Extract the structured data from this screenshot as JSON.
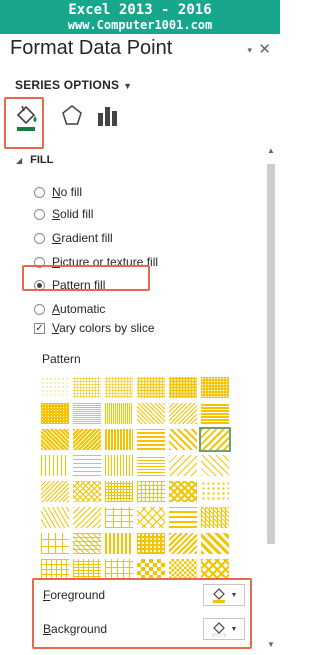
{
  "banner": {
    "line1": "Excel 2013 - 2016",
    "line2": "www.Computer1001.com"
  },
  "pane": {
    "title": "Format Data Point",
    "options_chevron": "▾",
    "close": "✕"
  },
  "series_options": {
    "label": "SERIES OPTIONS",
    "caret": "▼"
  },
  "category_tabs": [
    {
      "icon": "paint-bucket-icon",
      "selected": true
    },
    {
      "icon": "pentagon-icon",
      "selected": false
    },
    {
      "icon": "bar-chart-icon",
      "selected": false
    }
  ],
  "fill": {
    "header": "FILL",
    "options": [
      {
        "label": "No fill",
        "ul": "N",
        "rest": "o fill",
        "checked": false
      },
      {
        "label": "Solid fill",
        "ul": "S",
        "rest": "olid fill",
        "checked": false
      },
      {
        "label": "Gradient fill",
        "ul": "G",
        "rest": "radient fill",
        "checked": false
      },
      {
        "label": "Picture or texture fill",
        "ul": "P",
        "rest": "icture or texture fill",
        "checked": false
      },
      {
        "label": "Pattern fill",
        "ul": "",
        "rest": "Pattern fill",
        "checked": true
      },
      {
        "label": "Automatic",
        "ul": "A",
        "rest": "utomatic",
        "checked": false
      }
    ],
    "vary_colors": {
      "ul": "V",
      "rest": "ary colors by slice",
      "checked": true
    }
  },
  "pattern": {
    "label": "Pattern",
    "selected_index": 17
  },
  "foreground": {
    "ul": "F",
    "rest": "oreground"
  },
  "background": {
    "ul": "B",
    "rest": "ackground"
  },
  "colors": {
    "pattern_fg": "#f5c400",
    "pattern_bg": "#ffffff",
    "highlight": "#e8684a",
    "banner": "#18a78c"
  }
}
